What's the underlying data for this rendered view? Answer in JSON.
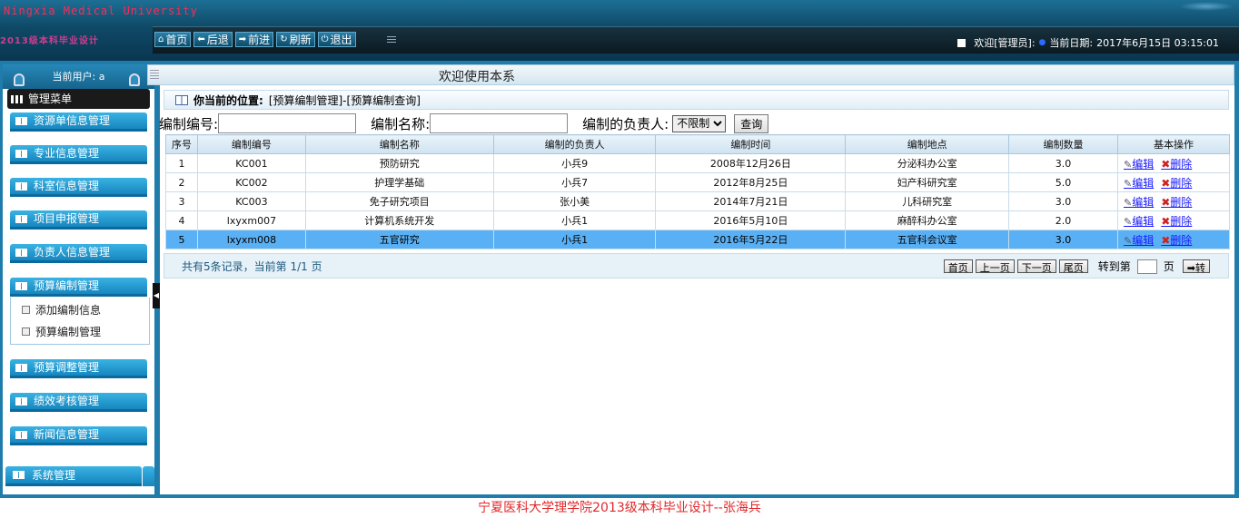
{
  "header": {
    "school": "Ningxia Medical University",
    "marquee": "2013级本科毕业设计",
    "nav": [
      {
        "label": "首页",
        "icon": "home-icon"
      },
      {
        "label": "后退",
        "icon": "arrow-left-icon"
      },
      {
        "label": "前进",
        "icon": "arrow-right-icon"
      },
      {
        "label": "刷新",
        "icon": "refresh-icon"
      },
      {
        "label": "退出",
        "icon": "power-icon"
      }
    ],
    "welcome": "欢迎[管理员]:",
    "date_label": "当前日期:",
    "date": "2017年6月15日 03:15:01"
  },
  "sidebar": {
    "current_user": "当前用户: a",
    "menu_title": "管理菜单",
    "items": [
      "资源单信息管理",
      "专业信息管理",
      "科室信息管理",
      "项目申报管理",
      "负责人信息管理",
      "预算编制管理",
      "预算调整管理",
      "绩效考核管理",
      "新闻信息管理"
    ],
    "sub_items": [
      "添加编制信息",
      "预算编制管理"
    ],
    "system": "系统管理"
  },
  "main": {
    "welcome_title": "欢迎使用本系",
    "location_label": "你当前的位置:",
    "location_path": "[预算编制管理]-[预算编制查询]",
    "search": {
      "code_label": "编制编号:",
      "name_label": "编制名称:",
      "owner_label": "编制的负责人:",
      "owner_value": "不限制",
      "query_button": "查询"
    },
    "table": {
      "columns": [
        "序号",
        "编制编号",
        "编制名称",
        "编制的负责人",
        "编制时间",
        "编制地点",
        "编制数量",
        "基本操作"
      ],
      "rows": [
        [
          "1",
          "KC001",
          "预防研究",
          "小兵9",
          "2008年12月26日",
          "分泌科办公室",
          "3.0"
        ],
        [
          "2",
          "KC002",
          "护理学基础",
          "小兵7",
          "2012年8月25日",
          "妇产科研究室",
          "5.0"
        ],
        [
          "3",
          "KC003",
          "免子研究项目",
          "张小美",
          "2014年7月21日",
          "儿科研究室",
          "3.0"
        ],
        [
          "4",
          "lxyxm007",
          "计算机系统开发",
          "小兵1",
          "2016年5月10日",
          "麻醉科办公室",
          "2.0"
        ],
        [
          "5",
          "lxyxm008",
          "五官研究",
          "小兵1",
          "2016年5月22日",
          "五官科会议室",
          "3.0"
        ]
      ],
      "selected_row": 5,
      "edit_label": "编辑",
      "delete_label": "删除"
    },
    "pager": {
      "info": "共有5条记录，当前第 1/1 页",
      "first": "首页",
      "prev": "上一页",
      "next": "下一页",
      "last": "尾页",
      "goto_label": "转到第",
      "page_unit": "页",
      "go": "➡转"
    }
  },
  "footer": "宁夏医科大学理学院2013级本科毕业设计--张海兵",
  "colors": {
    "frame": "#1f7cab",
    "menu": "#1686bf",
    "selected_row": "#5ab0f4",
    "footer_text": "#e0282a"
  }
}
